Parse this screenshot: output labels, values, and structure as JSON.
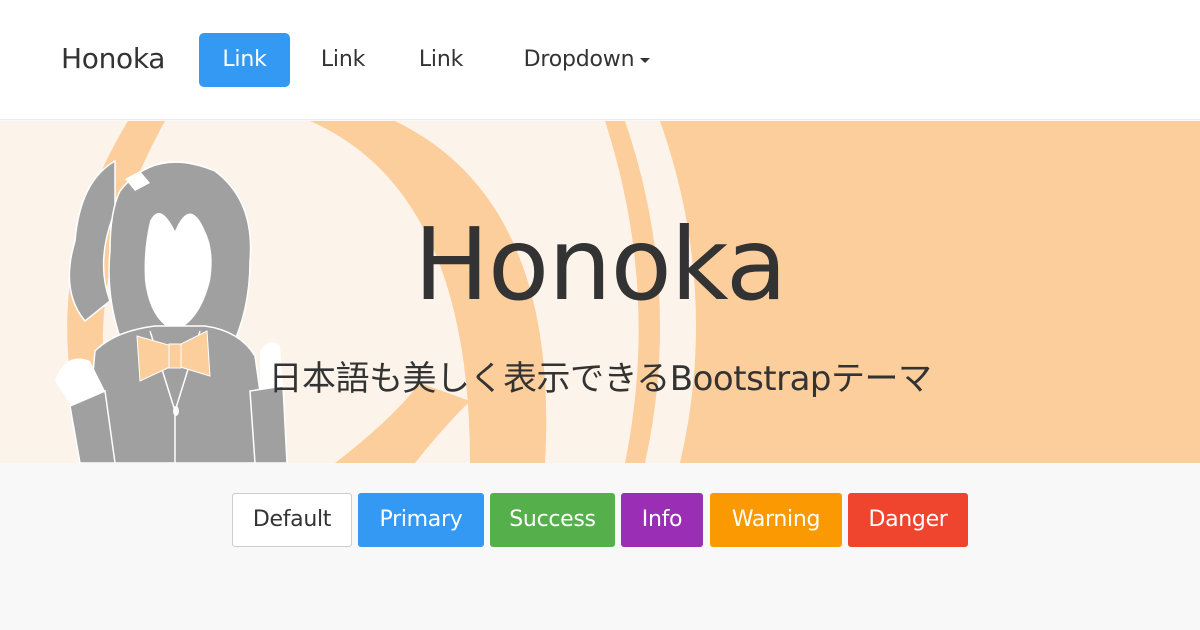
{
  "navbar": {
    "brand": "Honoka",
    "links": [
      {
        "label": "Link",
        "active": true
      },
      {
        "label": "Link",
        "active": false
      },
      {
        "label": "Link",
        "active": false
      },
      {
        "label": "Dropdown",
        "active": false,
        "icon": "caret-down-icon"
      }
    ]
  },
  "hero": {
    "title": "Honoka",
    "subtitle": "日本語も美しく表示できるBootstrapテーマ",
    "illustration": "anime-girl-silhouette",
    "colors": {
      "background": "#fcf4ea",
      "accent": "#fcce9b",
      "figure": "#a0a0a0"
    }
  },
  "buttons": [
    {
      "label": "Default",
      "variant": "default",
      "color": "#ffffff"
    },
    {
      "label": "Primary",
      "variant": "primary",
      "color": "#3399f3"
    },
    {
      "label": "Success",
      "variant": "success",
      "color": "#55af4b"
    },
    {
      "label": "Info",
      "variant": "info",
      "color": "#9a2eb5"
    },
    {
      "label": "Warning",
      "variant": "warning",
      "color": "#fa9901"
    },
    {
      "label": "Danger",
      "variant": "danger",
      "color": "#ef452f"
    }
  ]
}
